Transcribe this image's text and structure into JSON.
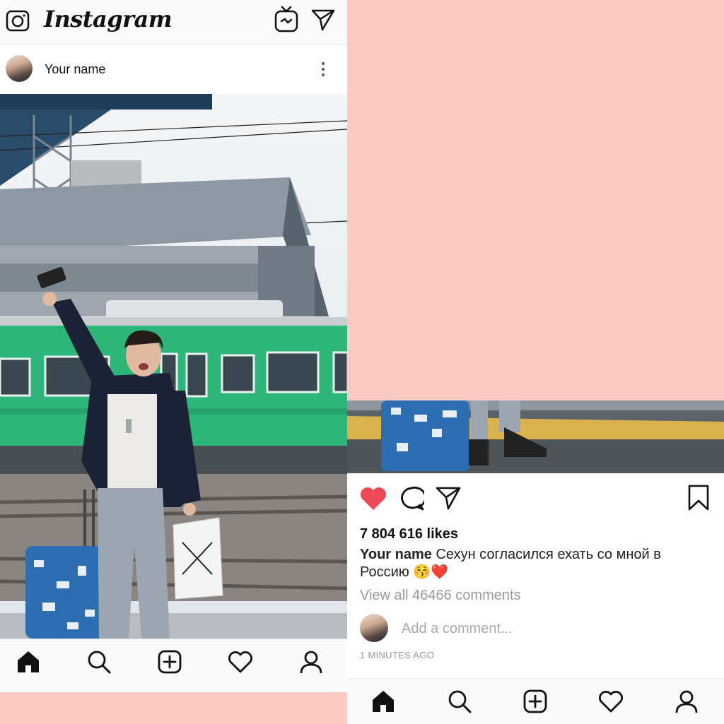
{
  "app": {
    "brand": "Instagram"
  },
  "post": {
    "username": "Your name",
    "likes": "7 804 616 likes",
    "caption_user": "Your name",
    "caption_text": "Сехун согласился ехать со мной в Россию 😚❤️",
    "view_comments": "View all 46466 comments",
    "add_comment_placeholder": "Add a comment...",
    "time": "1 MINUTES AGO"
  },
  "nav": [
    "home-icon",
    "search-icon",
    "new-post-icon",
    "activity-heart-icon",
    "profile-icon"
  ],
  "colors": {
    "background": "#fccac5",
    "like_red": "#ed4956",
    "train_green": "#2db57a"
  }
}
